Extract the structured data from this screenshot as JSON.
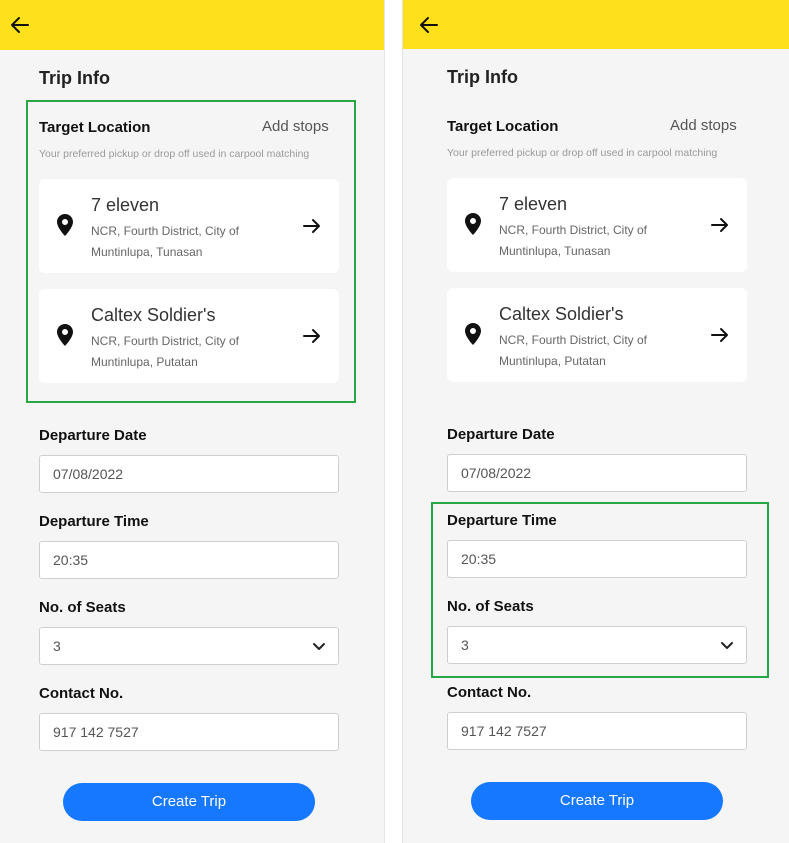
{
  "screens": [
    {
      "title": "Trip Info",
      "target_location": {
        "label": "Target Location",
        "add_stops": "Add stops",
        "hint": "Your preferred pickup or drop off used in carpool matching"
      },
      "locations": [
        {
          "name": "7 eleven",
          "address": "NCR, Fourth District, City of Muntinlupa, Tunasan"
        },
        {
          "name": "Caltex Soldier's",
          "address": "NCR, Fourth District, City of Muntinlupa, Putatan"
        }
      ],
      "departure_date": {
        "label": "Departure Date",
        "value": "07/08/2022"
      },
      "departure_time": {
        "label": "Departure Time",
        "value": "20:35"
      },
      "seats": {
        "label": "No. of Seats",
        "value": "3"
      },
      "contact": {
        "label": "Contact No.",
        "value": "917 142 7527"
      },
      "create_button": "Create Trip"
    },
    {
      "title": "Trip Info",
      "target_location": {
        "label": "Target Location",
        "add_stops": "Add stops",
        "hint": "Your preferred pickup or drop off used in carpool matching"
      },
      "locations": [
        {
          "name": "7 eleven",
          "address": "NCR, Fourth District, City of Muntinlupa, Tunasan"
        },
        {
          "name": "Caltex Soldier's",
          "address": "NCR, Fourth District, City of Muntinlupa, Putatan"
        }
      ],
      "departure_date": {
        "label": "Departure Date",
        "value": "07/08/2022"
      },
      "departure_time": {
        "label": "Departure Time",
        "value": "20:35"
      },
      "seats": {
        "label": "No. of Seats",
        "value": "3"
      },
      "contact": {
        "label": "Contact No.",
        "value": "917 142 7527"
      },
      "create_button": "Create Trip"
    }
  ],
  "colors": {
    "header": "#ffe01b",
    "primary_button": "#1677ff",
    "highlight": "#27a844",
    "background": "#f5f5f5"
  },
  "icons": [
    "back-arrow-icon",
    "location-pin-icon",
    "arrow-right-icon",
    "chevron-down-icon"
  ]
}
